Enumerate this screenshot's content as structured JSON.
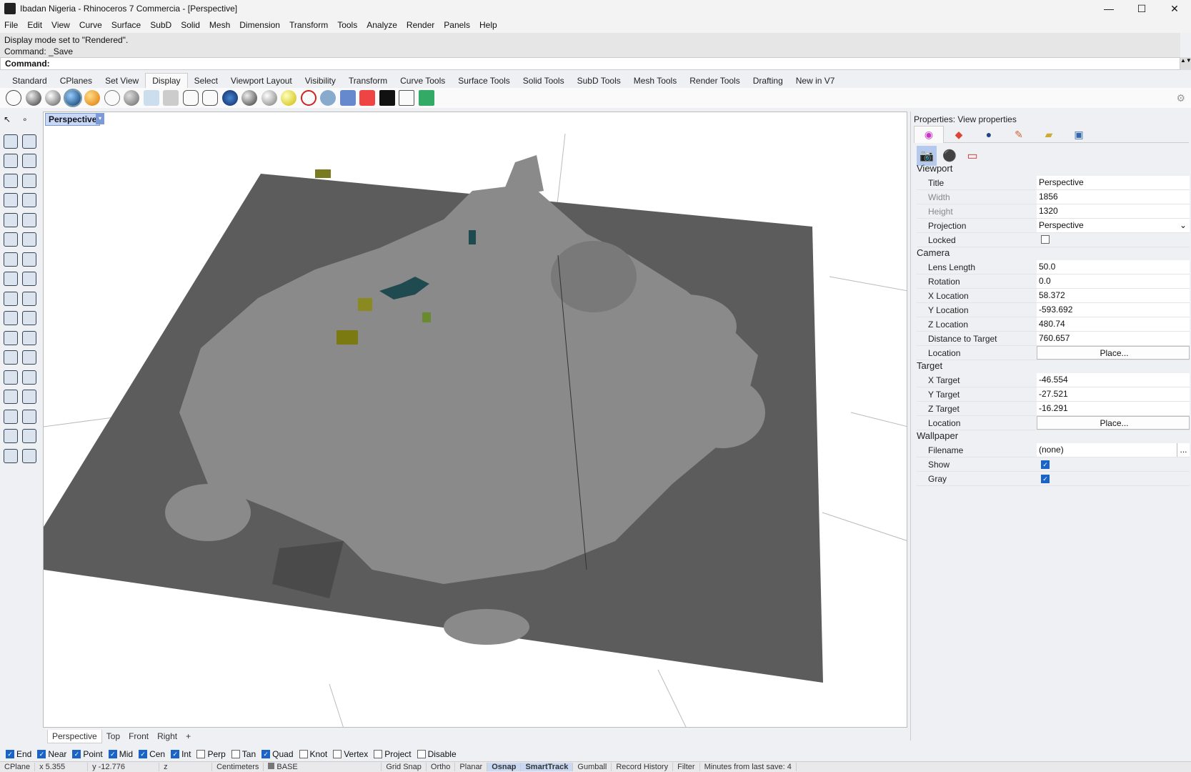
{
  "window": {
    "title": "Ibadan Nigeria - Rhinoceros 7 Commercia - [Perspective]",
    "minimize": "—",
    "maximize": "☐",
    "close": "✕"
  },
  "menu": [
    "File",
    "Edit",
    "View",
    "Curve",
    "Surface",
    "SubD",
    "Solid",
    "Mesh",
    "Dimension",
    "Transform",
    "Tools",
    "Analyze",
    "Render",
    "Panels",
    "Help"
  ],
  "command": {
    "history1": "Display mode set to \"Rendered\".",
    "history2": "Command: _Save",
    "prompt": "Command:"
  },
  "toolbar_tabs": [
    "Standard",
    "CPlanes",
    "Set View",
    "Display",
    "Select",
    "Viewport Layout",
    "Visibility",
    "Transform",
    "Curve Tools",
    "Surface Tools",
    "Solid Tools",
    "SubD Tools",
    "Mesh Tools",
    "Render Tools",
    "Drafting",
    "New in V7"
  ],
  "active_tab": "Display",
  "viewport": {
    "label": "Perspective",
    "dropdown": "▾"
  },
  "viewport_tabs": [
    "Perspective",
    "Top",
    "Front",
    "Right",
    "+"
  ],
  "properties": {
    "header": "Properties: View properties",
    "sections": {
      "viewport": {
        "title": "Viewport",
        "title_label": "Title",
        "title_value": "Perspective",
        "width_label": "Width",
        "width_value": "1856",
        "height_label": "Height",
        "height_value": "1320",
        "projection_label": "Projection",
        "projection_value": "Perspective",
        "locked_label": "Locked"
      },
      "camera": {
        "title": "Camera",
        "lens_label": "Lens Length",
        "lens_value": "50.0",
        "rotation_label": "Rotation",
        "rotation_value": "0.0",
        "xloc_label": "X Location",
        "xloc_value": "58.372",
        "yloc_label": "Y Location",
        "yloc_value": "-593.692",
        "zloc_label": "Z Location",
        "zloc_value": "480.74",
        "dist_label": "Distance to Target",
        "dist_value": "760.657",
        "location_label": "Location",
        "place": "Place..."
      },
      "target": {
        "title": "Target",
        "x_label": "X Target",
        "x_value": "-46.554",
        "y_label": "Y Target",
        "y_value": "-27.521",
        "z_label": "Z Target",
        "z_value": "-16.291",
        "location_label": "Location",
        "place": "Place..."
      },
      "wallpaper": {
        "title": "Wallpaper",
        "filename_label": "Filename",
        "filename_value": "(none)",
        "browse": "...",
        "show_label": "Show",
        "gray_label": "Gray"
      }
    }
  },
  "osnap": [
    {
      "label": "End",
      "on": true
    },
    {
      "label": "Near",
      "on": true
    },
    {
      "label": "Point",
      "on": true
    },
    {
      "label": "Mid",
      "on": true
    },
    {
      "label": "Cen",
      "on": true
    },
    {
      "label": "Int",
      "on": true
    },
    {
      "label": "Perp",
      "on": false
    },
    {
      "label": "Tan",
      "on": false
    },
    {
      "label": "Quad",
      "on": true
    },
    {
      "label": "Knot",
      "on": false
    },
    {
      "label": "Vertex",
      "on": false
    },
    {
      "label": "Project",
      "on": false
    },
    {
      "label": "Disable",
      "on": false
    }
  ],
  "status": {
    "cplane": "CPlane",
    "x": "x 5.355",
    "y": "y -12.776",
    "z": "z",
    "units": "Centimeters",
    "layer": "BASE",
    "grid_snap": "Grid Snap",
    "ortho": "Ortho",
    "planar": "Planar",
    "osnap": "Osnap",
    "smarttrack": "SmartTrack",
    "gumball": "Gumball",
    "record": "Record History",
    "filter": "Filter",
    "save": "Minutes from last save: 4"
  }
}
